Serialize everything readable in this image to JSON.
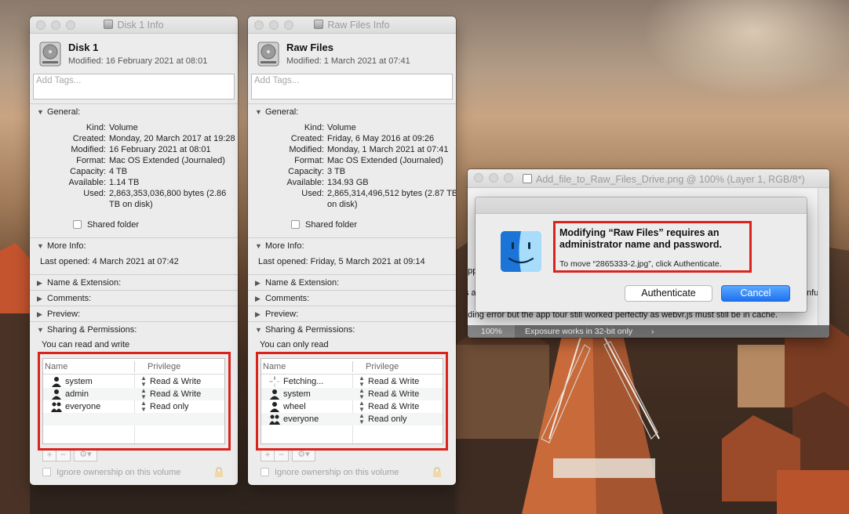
{
  "windows": {
    "disk1": {
      "title": "Disk 1 Info",
      "name": "Disk 1",
      "modified": "Modified: 16 February 2021 at 08:01",
      "tags_placeholder": "Add Tags...",
      "general_label": "General:",
      "general": [
        {
          "label": "Kind:",
          "value": "Volume"
        },
        {
          "label": "Created:",
          "value": "Monday, 20 March 2017 at 19:28"
        },
        {
          "label": "Modified:",
          "value": "16 February 2021 at 08:01"
        },
        {
          "label": "Format:",
          "value": "Mac OS Extended (Journaled)"
        },
        {
          "label": "Capacity:",
          "value": "4 TB"
        },
        {
          "label": "Available:",
          "value": "1.14 TB"
        },
        {
          "label": "Used:",
          "value": "2,863,353,036,800 bytes (2.86"
        },
        {
          "label": "",
          "value": "TB on disk)"
        }
      ],
      "shared_folder": "Shared folder",
      "more_info_label": "More Info:",
      "last_opened": "Last opened: 4 March 2021 at 07:42",
      "name_ext": "Name & Extension:",
      "comments": "Comments:",
      "preview": "Preview:",
      "sharing": "Sharing & Permissions:",
      "access": "You can read and write",
      "col_name": "Name",
      "col_privilege": "Privilege",
      "perms": [
        {
          "name": "system",
          "privilege": "Read & Write",
          "icon": "user-icon"
        },
        {
          "name": "admin",
          "privilege": "Read & Write",
          "icon": "user-icon"
        },
        {
          "name": "everyone",
          "privilege": "Read only",
          "icon": "group-icon"
        }
      ],
      "ignore_ownership": "Ignore ownership on this volume"
    },
    "raw": {
      "title": "Raw Files Info",
      "name": "Raw Files",
      "modified": "Modified: 1 March 2021 at 07:41",
      "tags_placeholder": "Add Tags...",
      "general_label": "General:",
      "general": [
        {
          "label": "Kind:",
          "value": "Volume"
        },
        {
          "label": "Created:",
          "value": "Friday, 6 May 2016 at 09:26"
        },
        {
          "label": "Modified:",
          "value": "Monday, 1 March 2021 at 07:41"
        },
        {
          "label": "Format:",
          "value": "Mac OS Extended (Journaled)"
        },
        {
          "label": "Capacity:",
          "value": "3 TB"
        },
        {
          "label": "Available:",
          "value": "134.93 GB"
        },
        {
          "label": "Used:",
          "value": "2,865,314,496,512 bytes (2.87 TB"
        },
        {
          "label": "",
          "value": "on disk)"
        }
      ],
      "shared_folder": "Shared folder",
      "more_info_label": "More Info:",
      "last_opened": "Last opened: Friday, 5 March 2021 at 09:14",
      "name_ext": "Name & Extension:",
      "comments": "Comments:",
      "preview": "Preview:",
      "sharing": "Sharing & Permissions:",
      "access": "You can only read",
      "col_name": "Name",
      "col_privilege": "Privilege",
      "perms": [
        {
          "name": "Fetching...",
          "privilege": "Read & Write",
          "icon": "spinner-icon"
        },
        {
          "name": "system",
          "privilege": "Read & Write",
          "icon": "user-icon"
        },
        {
          "name": "wheel",
          "privilege": "Read & Write",
          "icon": "user-icon"
        },
        {
          "name": "everyone",
          "privilege": "Read only",
          "icon": "group-icon"
        }
      ],
      "ignore_ownership": "Ignore ownership on this volume"
    }
  },
  "photoshop": {
    "title": "Add_file_to_Raw_Files_Drive.png @ 100% (Layer 1, RGB/8*)",
    "doc_fragments": [
      "app",
      "s a",
      "nfu",
      "ading error but the app tour still worked perfectly as webvr.js must still be in cache."
    ],
    "zoom": "100%",
    "status": "Exposure works in 32-bit only",
    "arrow": "›"
  },
  "auth_dialog": {
    "title": "Modifying “Raw Files” requires an administrator name and password.",
    "subtitle": "To move “2865333-2.jpg”, click Authenticate.",
    "authenticate": "Authenticate",
    "cancel": "Cancel"
  },
  "colors": {
    "highlight": "#d9231c",
    "default_button": "#1f72f0"
  }
}
